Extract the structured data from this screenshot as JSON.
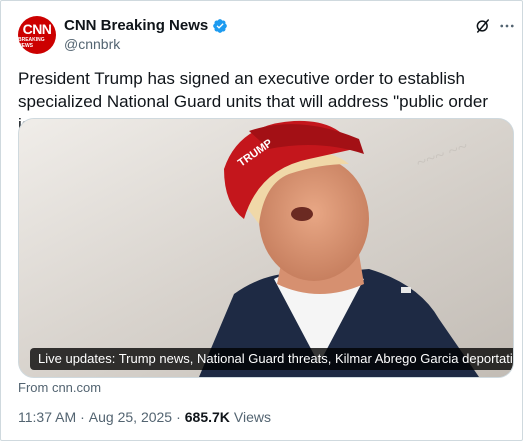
{
  "author": {
    "display_name": "CNN Breaking News",
    "handle": "@cnnbrk",
    "avatar_logo": "CNN",
    "avatar_logo_sub": "BREAKING NEWS",
    "verified": true
  },
  "header_icons": [
    "grok-icon",
    "more-icon"
  ],
  "tweet": {
    "text": "President Trump has signed an executive order to establish specialized National Guard units that will address \"public order issues\""
  },
  "media": {
    "caption": "Live updates: Trump news, National Guard threats, Kilmar Abrego Garcia deportation | ...",
    "hat_text": "TRUMP"
  },
  "link_source": "From cnn.com",
  "meta": {
    "time": "11:37 AM",
    "separator": "·",
    "date": "Aug 25, 2025",
    "separator2": "·",
    "views_count": "685.7K",
    "views_label": "Views"
  },
  "colors": {
    "cnn_red": "#cc0000",
    "verified_blue": "#1d9bf0",
    "text_primary": "#0f1419",
    "text_secondary": "#536471"
  }
}
